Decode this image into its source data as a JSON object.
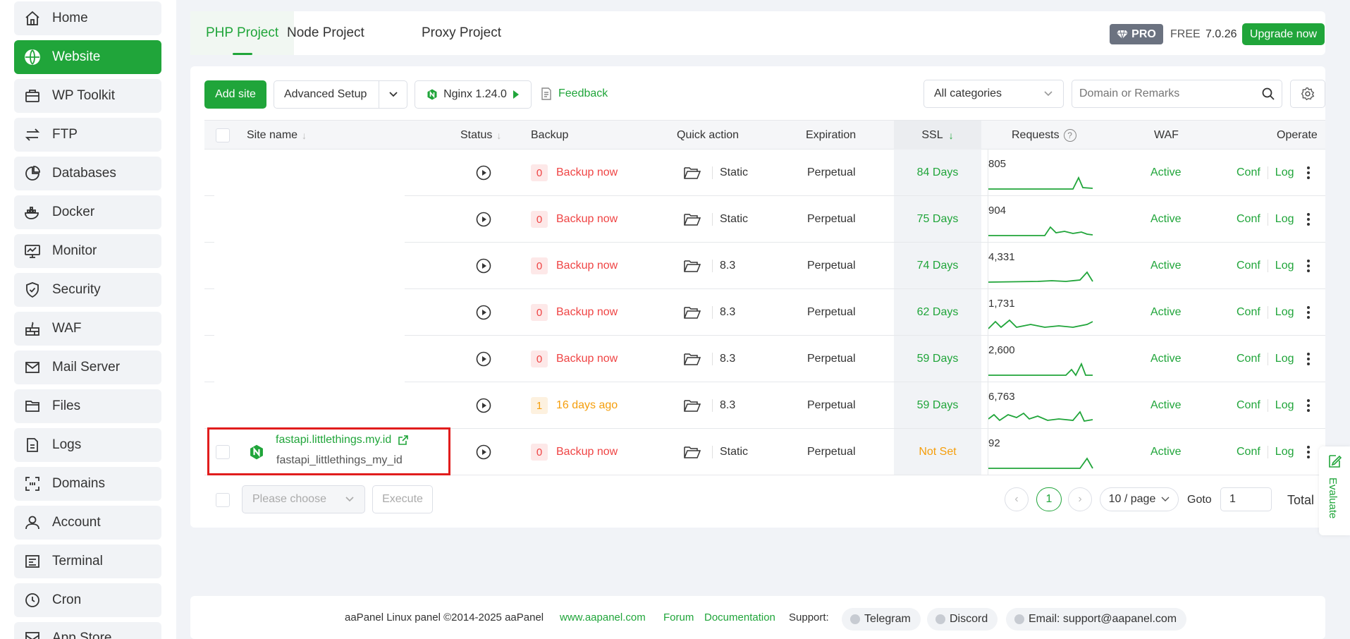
{
  "sidebar": {
    "items": [
      {
        "label": "Home",
        "icon": "home-icon"
      },
      {
        "label": "Website",
        "icon": "globe-icon",
        "active": true
      },
      {
        "label": "WP Toolkit",
        "icon": "wp-toolkit-icon"
      },
      {
        "label": "FTP",
        "icon": "ftp-icon"
      },
      {
        "label": "Databases",
        "icon": "database-icon"
      },
      {
        "label": "Docker",
        "icon": "docker-icon"
      },
      {
        "label": "Monitor",
        "icon": "monitor-icon"
      },
      {
        "label": "Security",
        "icon": "shield-icon"
      },
      {
        "label": "WAF",
        "icon": "firewall-icon"
      },
      {
        "label": "Mail Server",
        "icon": "mail-icon"
      },
      {
        "label": "Files",
        "icon": "folder-icon"
      },
      {
        "label": "Logs",
        "icon": "logs-icon"
      },
      {
        "label": "Domains",
        "icon": "domains-icon"
      },
      {
        "label": "Account",
        "icon": "user-icon"
      },
      {
        "label": "Terminal",
        "icon": "terminal-icon"
      },
      {
        "label": "Cron",
        "icon": "clock-icon"
      },
      {
        "label": "App Store",
        "icon": "store-icon"
      }
    ]
  },
  "header": {
    "tabs": [
      {
        "label": "PHP Project"
      },
      {
        "label": "Node Project"
      },
      {
        "label": "Proxy Project"
      }
    ],
    "pro_label": "PRO",
    "free_label": "FREE",
    "version": "7.0.26",
    "upgrade_label": "Upgrade now"
  },
  "toolbar": {
    "add_site": "Add site",
    "advanced_setup": "Advanced Setup",
    "nginx": "Nginx 1.24.0",
    "feedback": "Feedback",
    "category": "All categories",
    "search_placeholder": "Domain or Remarks"
  },
  "table": {
    "headers": {
      "site_name": "Site name",
      "status": "Status",
      "backup": "Backup",
      "quick_action": "Quick action",
      "expiration": "Expiration",
      "ssl": "SSL",
      "requests": "Requests",
      "waf": "WAF",
      "operate": "Operate"
    },
    "rows": [
      {
        "site": "",
        "remark": "",
        "backup_count": "0",
        "backup_text": "Backup now",
        "backup_state": "none",
        "php": "Static",
        "expiration": "Perpetual",
        "ssl": "84 Days",
        "ssl_state": "ok",
        "requests": "805",
        "waf": "Active",
        "conf": "Conf",
        "log": "Log"
      },
      {
        "site": "",
        "remark": "",
        "backup_count": "0",
        "backup_text": "Backup now",
        "backup_state": "none",
        "php": "Static",
        "expiration": "Perpetual",
        "ssl": "75 Days",
        "ssl_state": "ok",
        "requests": "904",
        "waf": "Active",
        "conf": "Conf",
        "log": "Log"
      },
      {
        "site": "",
        "remark": "",
        "backup_count": "0",
        "backup_text": "Backup now",
        "backup_state": "none",
        "php": "8.3",
        "expiration": "Perpetual",
        "ssl": "74 Days",
        "ssl_state": "ok",
        "requests": "4,331",
        "waf": "Active",
        "conf": "Conf",
        "log": "Log"
      },
      {
        "site": "",
        "remark": "",
        "backup_count": "0",
        "backup_text": "Backup now",
        "backup_state": "none",
        "php": "8.3",
        "expiration": "Perpetual",
        "ssl": "62 Days",
        "ssl_state": "ok",
        "requests": "1,731",
        "waf": "Active",
        "conf": "Conf",
        "log": "Log"
      },
      {
        "site": "",
        "remark": "",
        "backup_count": "0",
        "backup_text": "Backup now",
        "backup_state": "none",
        "php": "8.3",
        "expiration": "Perpetual",
        "ssl": "59 Days",
        "ssl_state": "ok",
        "requests": "2,600",
        "waf": "Active",
        "conf": "Conf",
        "log": "Log"
      },
      {
        "site": "",
        "remark": "",
        "backup_count": "1",
        "backup_text": "16 days ago",
        "backup_state": "recent",
        "php": "8.3",
        "expiration": "Perpetual",
        "ssl": "59 Days",
        "ssl_state": "ok",
        "requests": "6,763",
        "waf": "Active",
        "conf": "Conf",
        "log": "Log"
      },
      {
        "site": "fastapi.littlethings.my.id",
        "remark": "fastapi_littlethings_my_id",
        "backup_count": "0",
        "backup_text": "Backup now",
        "backup_state": "none",
        "php": "Static",
        "expiration": "Perpetual",
        "ssl": "Not Set",
        "ssl_state": "none",
        "requests": "92",
        "waf": "Active",
        "conf": "Conf",
        "log": "Log"
      }
    ]
  },
  "bulk": {
    "placeholder": "Please choose",
    "execute": "Execute"
  },
  "pagination": {
    "current": "1",
    "per_page": "10 / page",
    "goto_label": "Goto",
    "goto_value": "1",
    "total_label": "Total"
  },
  "footer": {
    "copyright": "aaPanel Linux panel ©2014-2025 aaPanel",
    "site_link": "www.aapanel.com",
    "forum": "Forum",
    "docs": "Documentation",
    "support_label": "Support:",
    "telegram": "Telegram",
    "discord": "Discord",
    "email": "Email: support@aapanel.com"
  },
  "evaluate": {
    "label": "Evaluate"
  },
  "colors": {
    "accent": "#20a53a",
    "danger": "#ef4444",
    "warning": "#f59e0b",
    "highlight_box": "#e11d1d"
  }
}
